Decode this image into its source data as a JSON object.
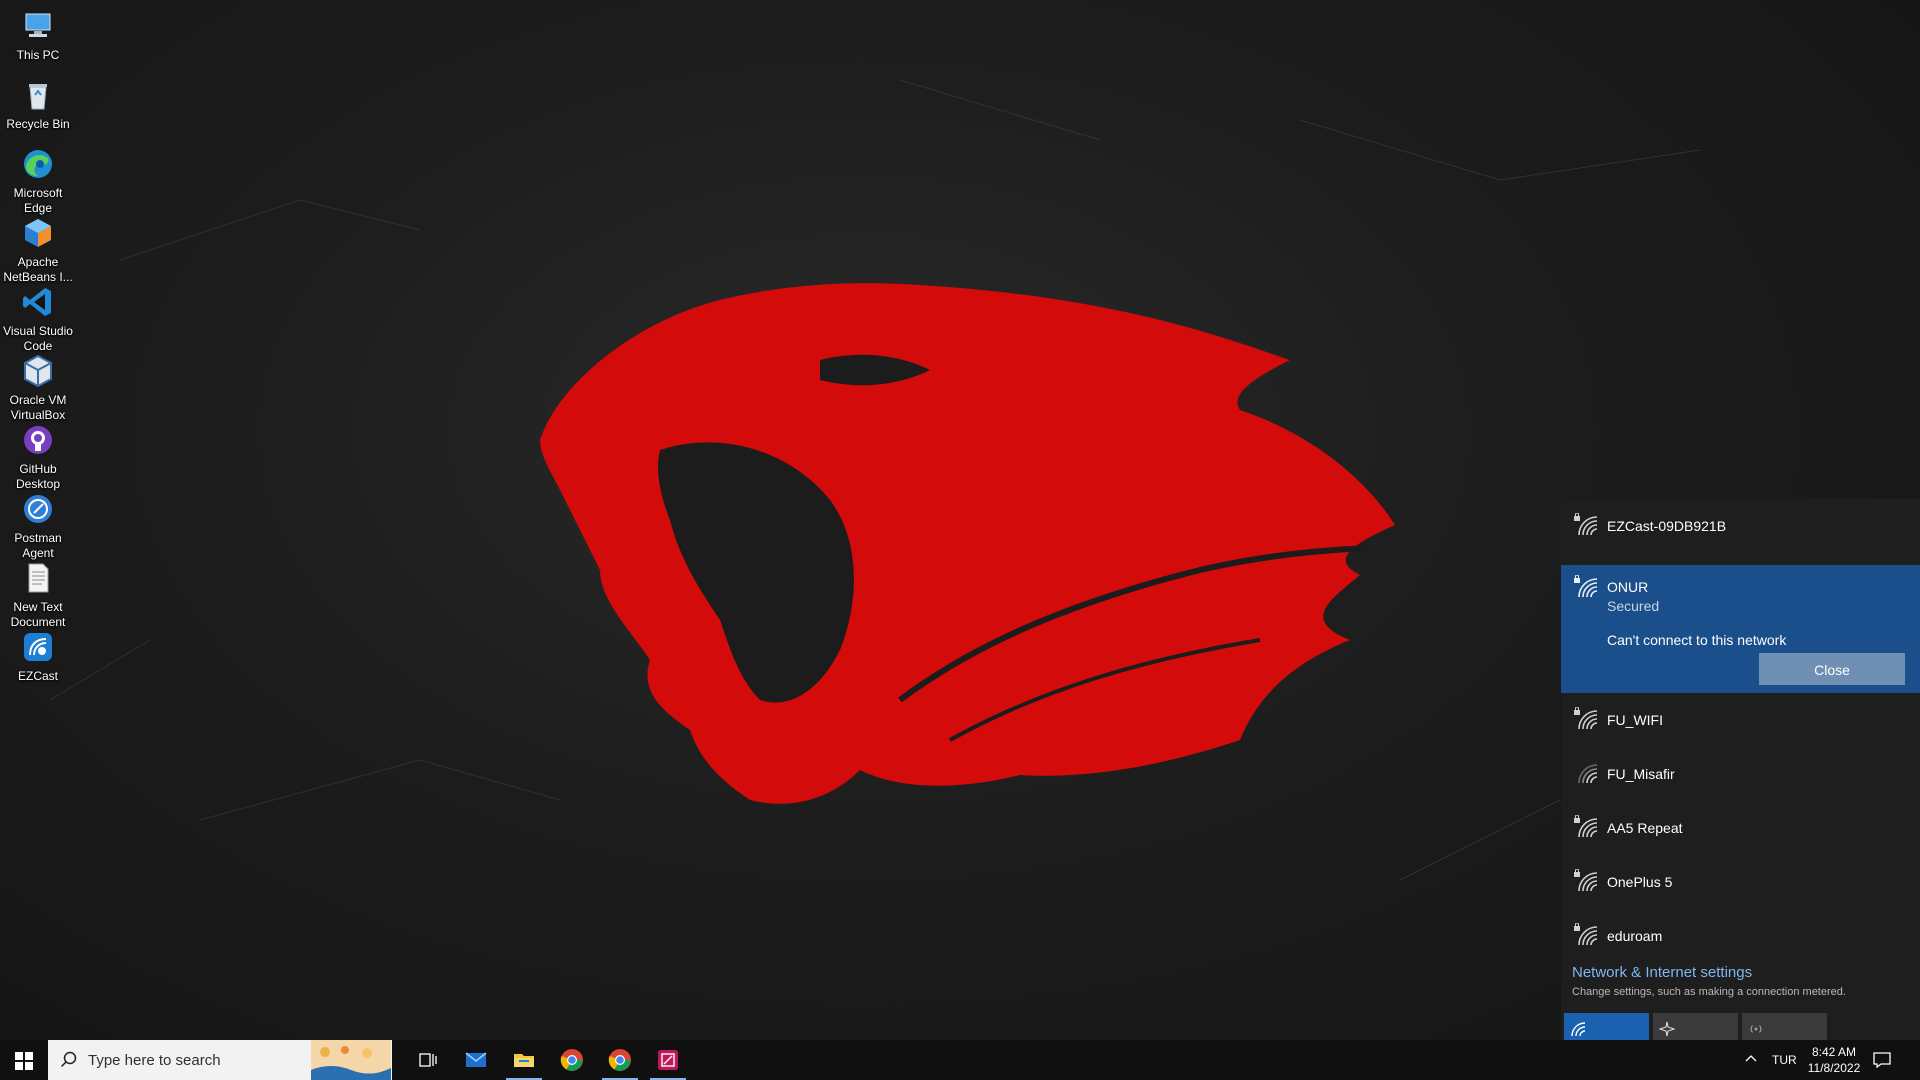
{
  "desktop": {
    "icons": [
      {
        "label": "This PC"
      },
      {
        "label": "Recycle Bin"
      },
      {
        "label": "Microsoft Edge"
      },
      {
        "label": "Apache NetBeans I..."
      },
      {
        "label": "Visual Studio Code"
      },
      {
        "label": "Oracle VM VirtualBox"
      },
      {
        "label": "GitHub Desktop"
      },
      {
        "label": "Postman Agent"
      },
      {
        "label": "New Text Document"
      },
      {
        "label": "EZCast"
      }
    ]
  },
  "network_flyout": {
    "networks": [
      {
        "name": "EZCast-09DB921B",
        "secured": true
      },
      {
        "name": "FU_WIFI",
        "secured": true
      },
      {
        "name": "FU_Misafir",
        "secured": false
      },
      {
        "name": "AA5 Repeat",
        "secured": true
      },
      {
        "name": "OnePlus 5",
        "secured": true
      },
      {
        "name": "eduroam",
        "secured": true
      }
    ],
    "selected": {
      "name": "ONUR",
      "status": "Secured",
      "message": "Can't connect to this network",
      "close_label": "Close"
    },
    "settings_link": "Network & Internet settings",
    "settings_desc": "Change settings, such as making a connection metered.",
    "quick_actions": [
      {
        "icon": "wifi-icon",
        "active": true
      },
      {
        "icon": "airplane-icon",
        "active": false
      },
      {
        "icon": "mobile-hotspot-icon",
        "active": false
      }
    ]
  },
  "taskbar": {
    "search_placeholder": "Type here to search",
    "apps": [
      "task-view-icon",
      "mail-icon",
      "file-explorer-icon",
      "chrome-icon",
      "chrome-icon",
      "snipping-tool-icon"
    ],
    "language": "TUR",
    "time": "8:42 AM",
    "date": "11/8/2022"
  },
  "colors": {
    "accent": "#1a4f8c",
    "wallpaper_red": "#d30b0b",
    "link": "#7fb6f0"
  }
}
